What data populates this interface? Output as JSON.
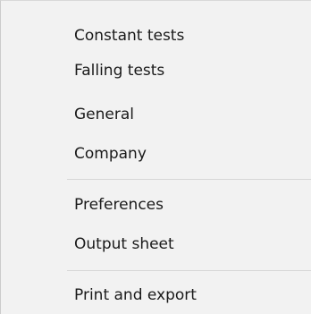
{
  "menu": {
    "items": [
      {
        "label": "Constant tests"
      },
      {
        "label": "Falling tests"
      },
      {
        "label": "General"
      },
      {
        "label": "Company"
      },
      {
        "label": "Preferences"
      },
      {
        "label": "Output sheet"
      },
      {
        "label": "Print and export"
      }
    ]
  }
}
